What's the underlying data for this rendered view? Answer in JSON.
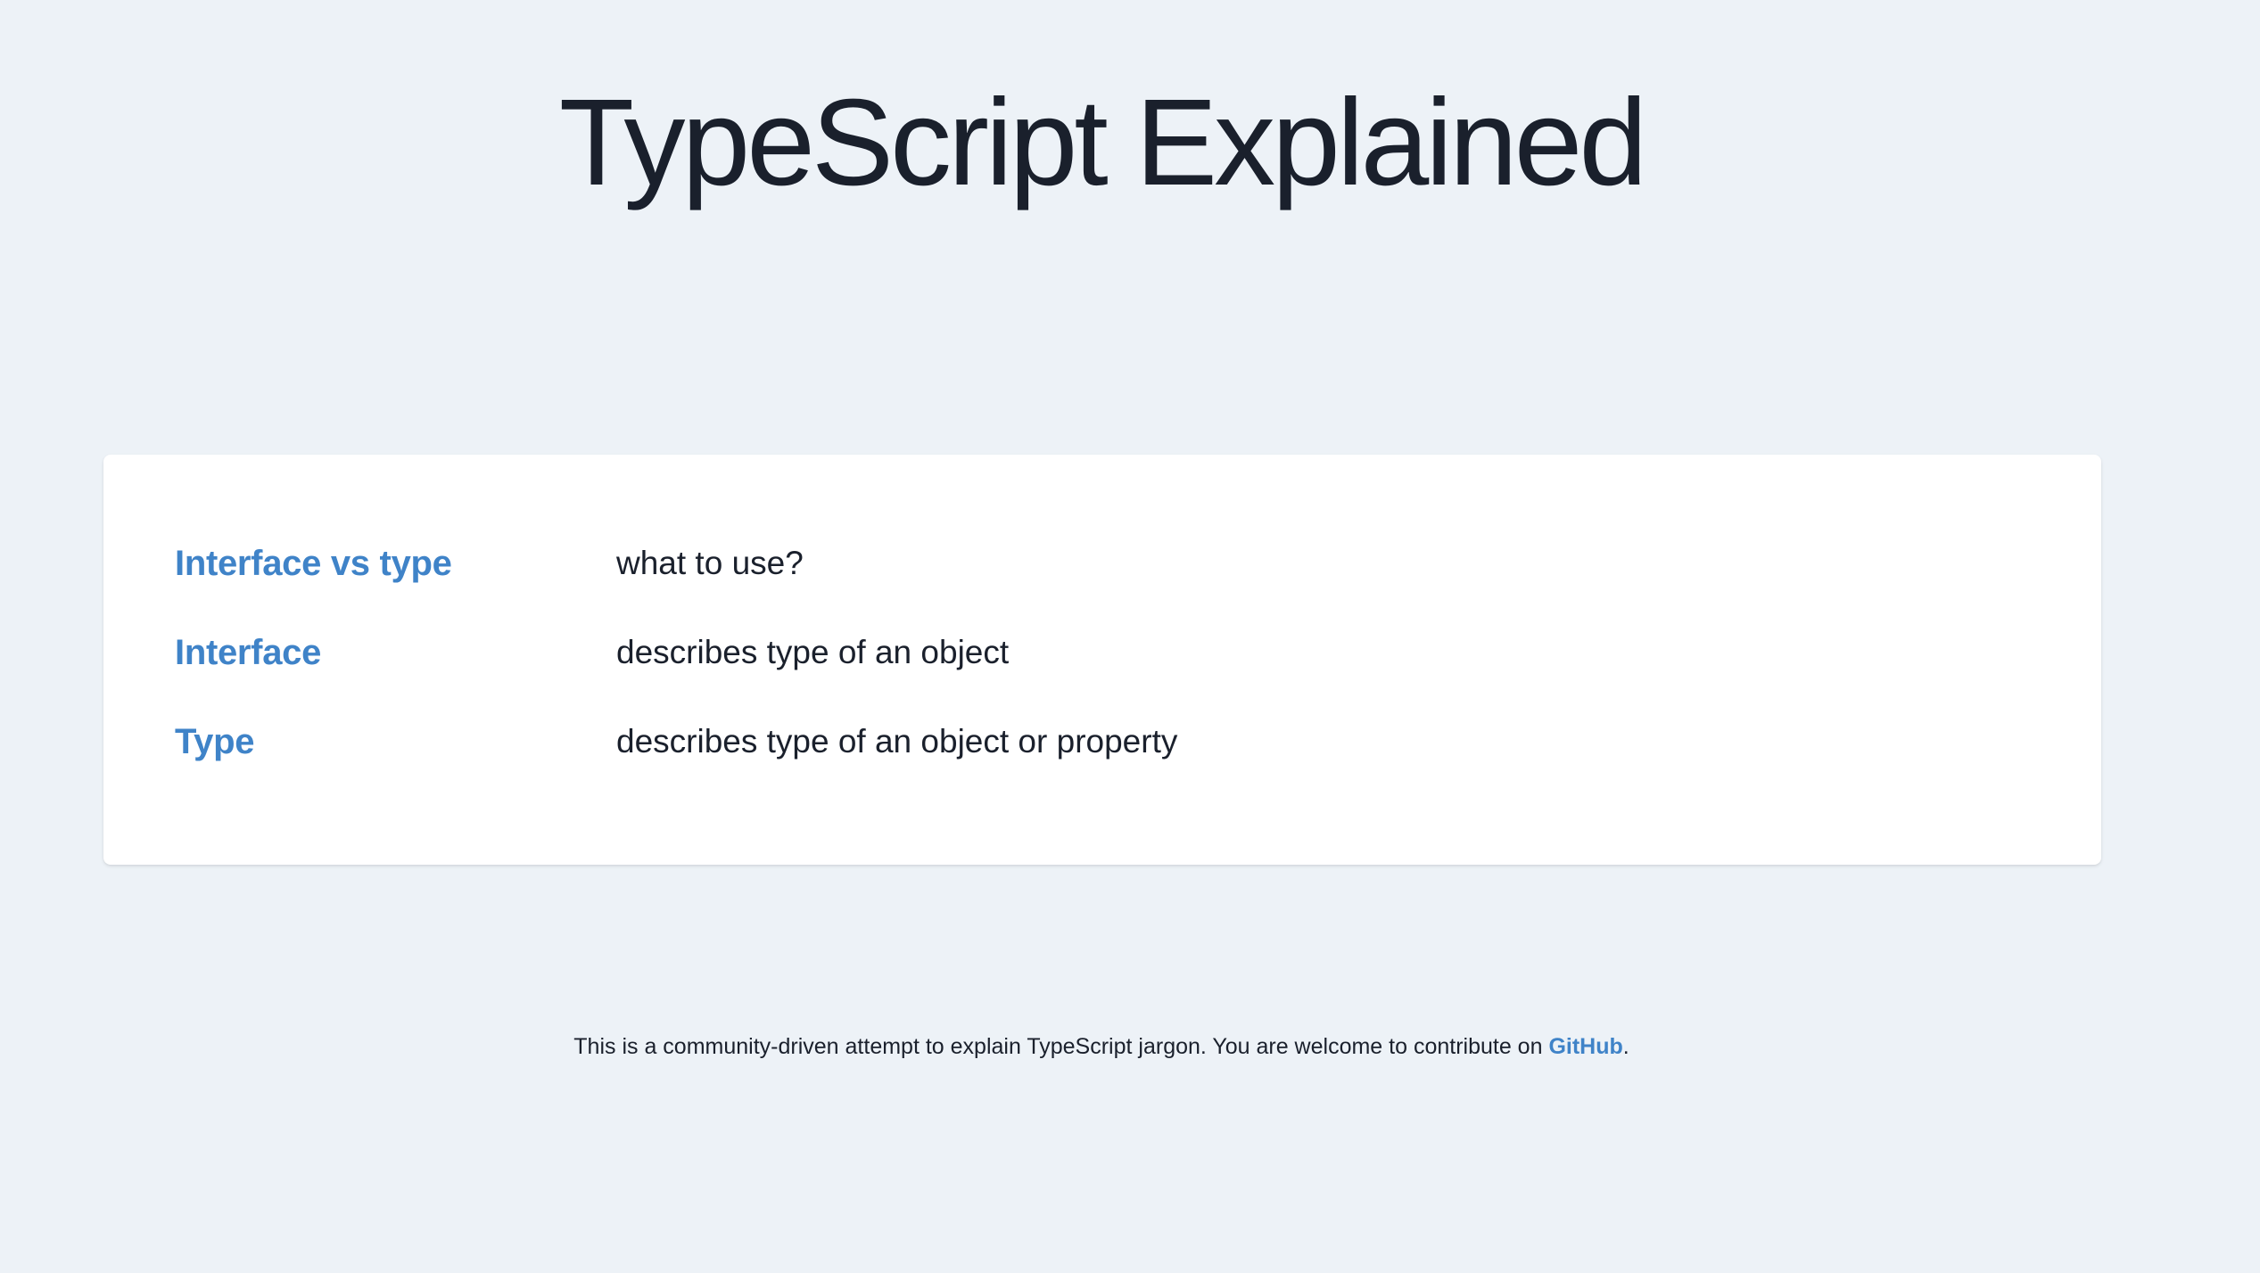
{
  "header": {
    "title": "TypeScript Explained"
  },
  "glossary": {
    "items": [
      {
        "term": "Interface vs type",
        "description": "what to use?"
      },
      {
        "term": "Interface",
        "description": "describes type of an object"
      },
      {
        "term": "Type",
        "description": "describes type of an object or property"
      }
    ]
  },
  "footer": {
    "text_before": "This is a community-driven attempt to explain TypeScript jargon. You are welcome to contribute on ",
    "link_label": "GitHub",
    "text_after": "."
  },
  "colors": {
    "background": "#edf2f7",
    "card": "#ffffff",
    "link": "#3f83c8",
    "text": "#1a202c"
  }
}
